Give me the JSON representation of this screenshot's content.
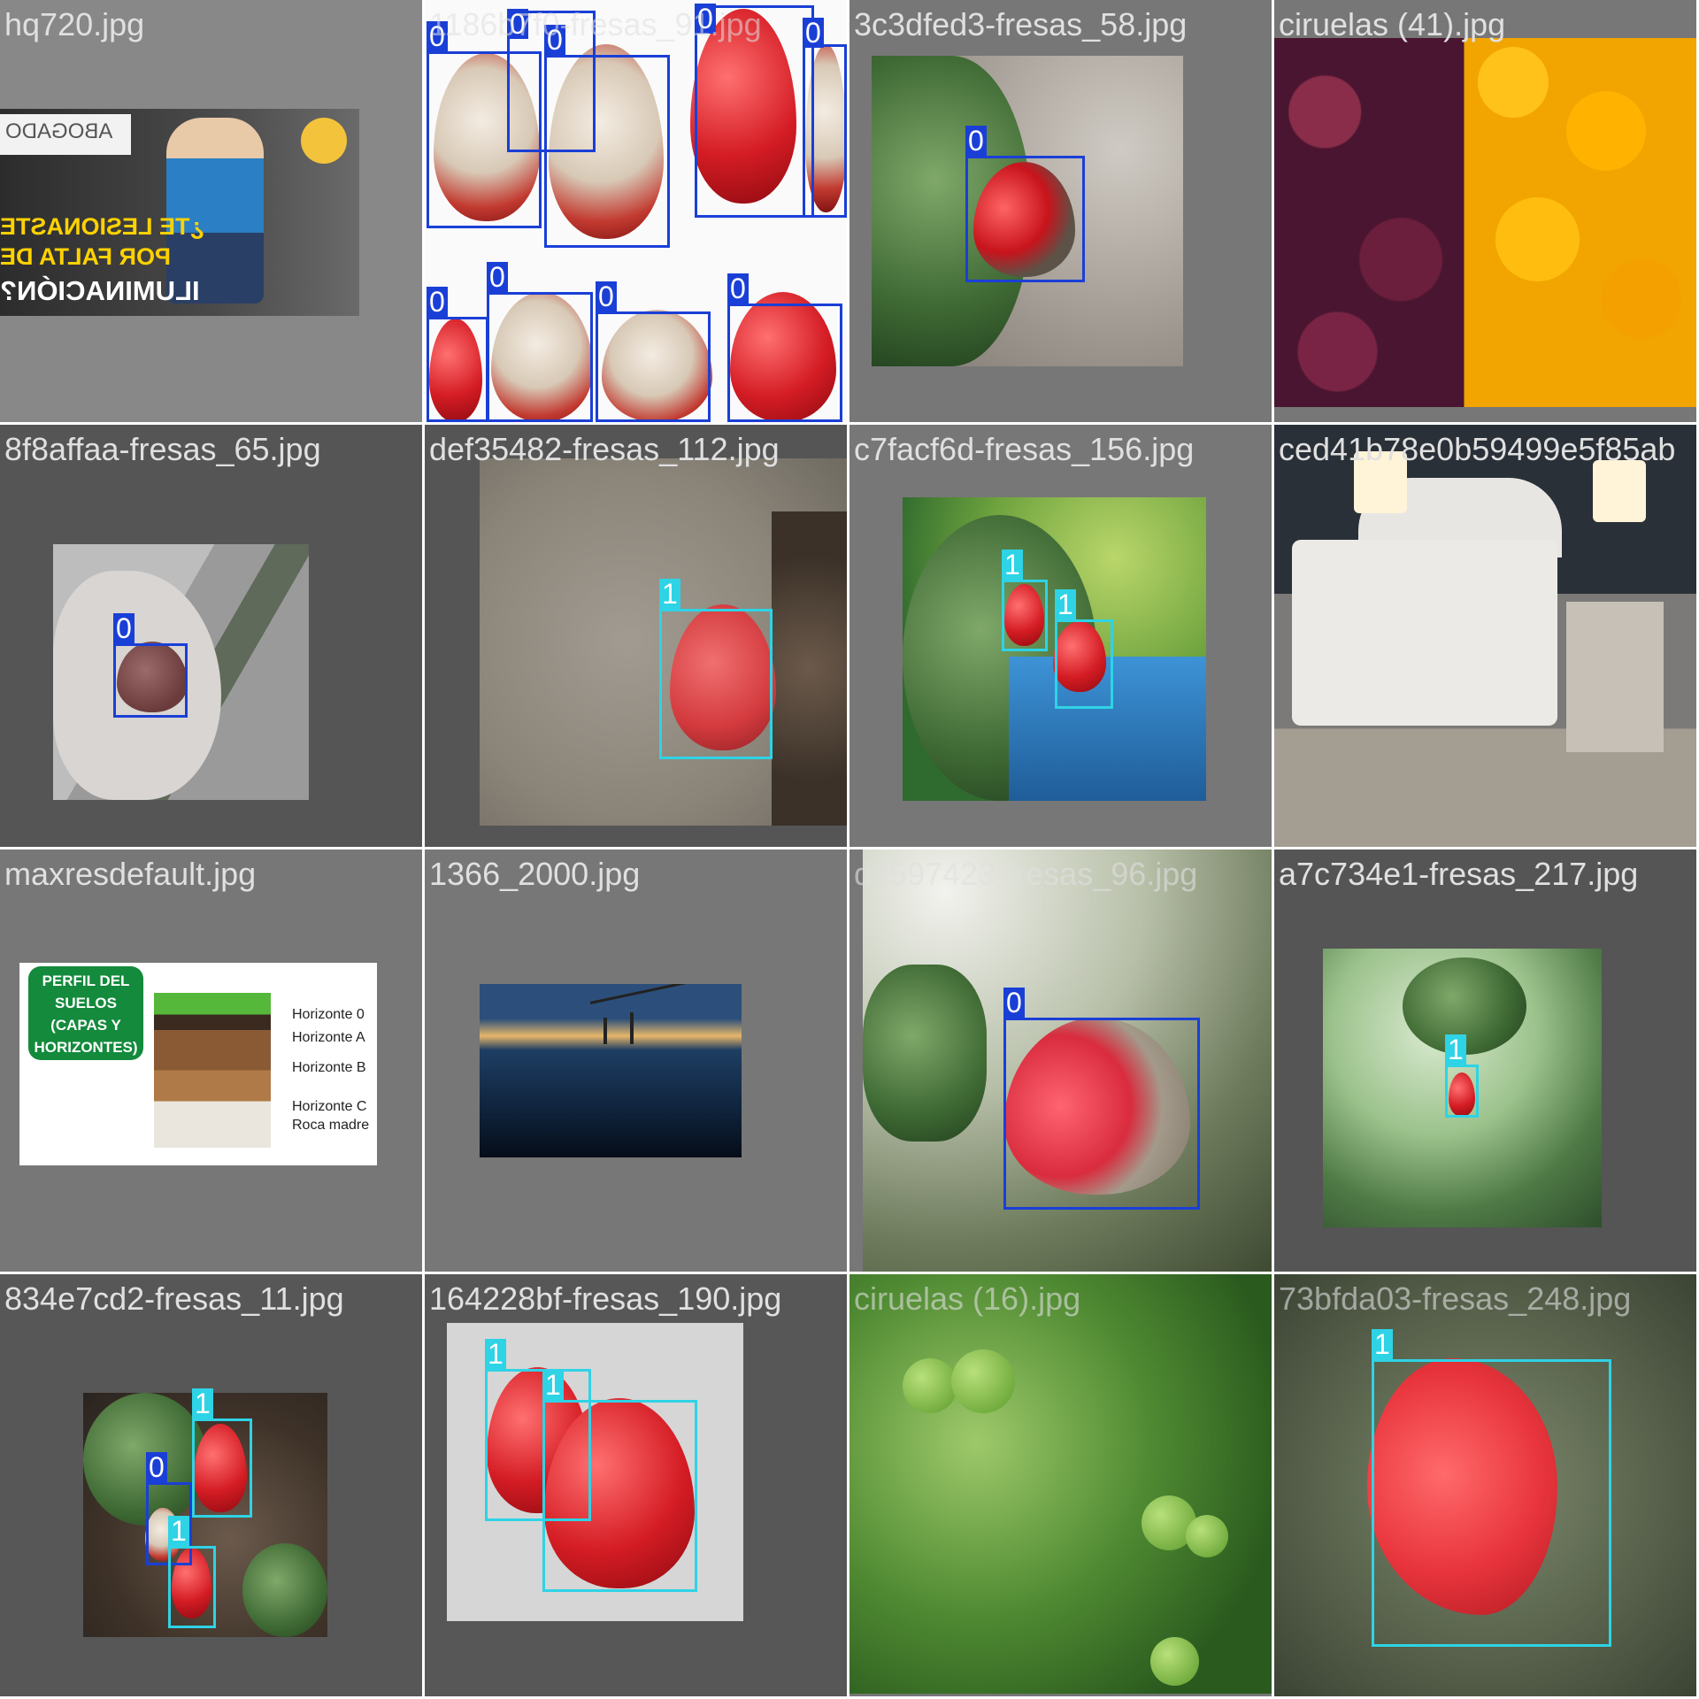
{
  "tiles": [
    {
      "filename": "hq720.jpg",
      "thumb_text": {
        "brand": "ABOGADO",
        "line1": "¿TE LESIONASTE",
        "line2": "POR FALTA DE",
        "line3": "ILUMINACIÓN?"
      }
    },
    {
      "filename": "1186b7f0-fresas_91.jpg"
    },
    {
      "filename": "3c3dfed3-fresas_58.jpg"
    },
    {
      "filename": "ciruelas (41).jpg"
    },
    {
      "filename": "8f8affaa-fresas_65.jpg"
    },
    {
      "filename": "def35482-fresas_112.jpg"
    },
    {
      "filename": "c7facf6d-fresas_156.jpg"
    },
    {
      "filename": "ced41b78e0b59499e5f85ab"
    },
    {
      "filename": "maxresdefault.jpg",
      "diagram": {
        "title_lines": [
          "PERFIL DEL",
          "SUELOS",
          "(CAPAS Y",
          "HORIZONTES)"
        ],
        "layers": [
          "Horizonte 0",
          "Horizonte A",
          "Horizonte B",
          "Horizonte C",
          "Roca madre"
        ]
      }
    },
    {
      "filename": "1366_2000.jpg"
    },
    {
      "filename": "d4597423-fresas_96.jpg"
    },
    {
      "filename": "a7c734e1-fresas_217.jpg"
    },
    {
      "filename": "834e7cd2-fresas_11.jpg"
    },
    {
      "filename": "164228bf-fresas_190.jpg"
    },
    {
      "filename": "ciruelas (16).jpg"
    },
    {
      "filename": "73bfda03-fresas_248.jpg"
    }
  ],
  "labels": {
    "class0": "0",
    "class1": "1"
  },
  "colors": {
    "class0": "#1a3fd6",
    "class1": "#2ed3e6",
    "tile_bg_light": "#777777",
    "tile_bg_dark": "#575757"
  }
}
